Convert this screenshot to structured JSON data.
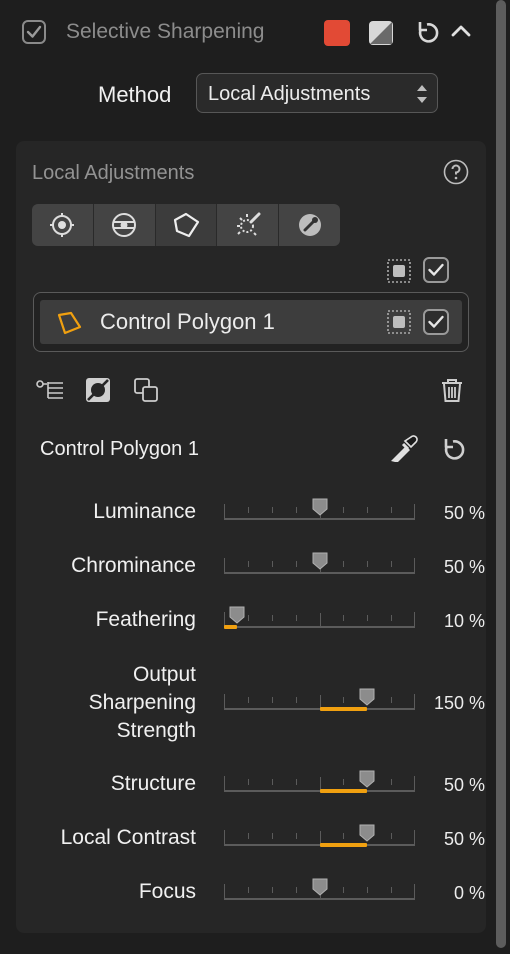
{
  "header": {
    "title": "Selective Sharpening",
    "enabled": true,
    "swatch_color": "#e24a35",
    "icons": [
      "tone-icon",
      "reset-icon",
      "chevron-up-icon"
    ]
  },
  "method": {
    "label": "Method",
    "value": "Local Adjustments"
  },
  "panel": {
    "title": "Local Adjustments",
    "tools": [
      "target-tool-icon",
      "radial-tool-icon",
      "polygon-tool-icon",
      "brush-tool-icon",
      "picker-tool-icon"
    ],
    "active_tool": 2
  },
  "layers": [
    {
      "name": "Control Polygon 1",
      "checked": true
    }
  ],
  "selected": {
    "name": "Control Polygon 1"
  },
  "sliders": [
    {
      "label": "Luminance",
      "value_text": "50 %",
      "level": 0.5,
      "fill_from": null,
      "fill_to": null
    },
    {
      "label": "Chrominance",
      "value_text": "50 %",
      "level": 0.5,
      "fill_from": null,
      "fill_to": null
    },
    {
      "label": "Feathering",
      "value_text": "10 %",
      "level": 0.07,
      "fill_from": 0,
      "fill_to": 0.07
    },
    {
      "label": "Output Sharpening Strength",
      "value_text": "150 %",
      "level": 0.75,
      "fill_from": 0.5,
      "fill_to": 0.75
    },
    {
      "label": "Structure",
      "value_text": "50 %",
      "level": 0.75,
      "fill_from": 0.5,
      "fill_to": 0.75
    },
    {
      "label": "Local Contrast",
      "value_text": "50 %",
      "level": 0.75,
      "fill_from": 0.5,
      "fill_to": 0.75
    },
    {
      "label": "Focus",
      "value_text": "0 %",
      "level": 0.5,
      "fill_from": null,
      "fill_to": null
    }
  ],
  "accent_color": "#f0a010"
}
